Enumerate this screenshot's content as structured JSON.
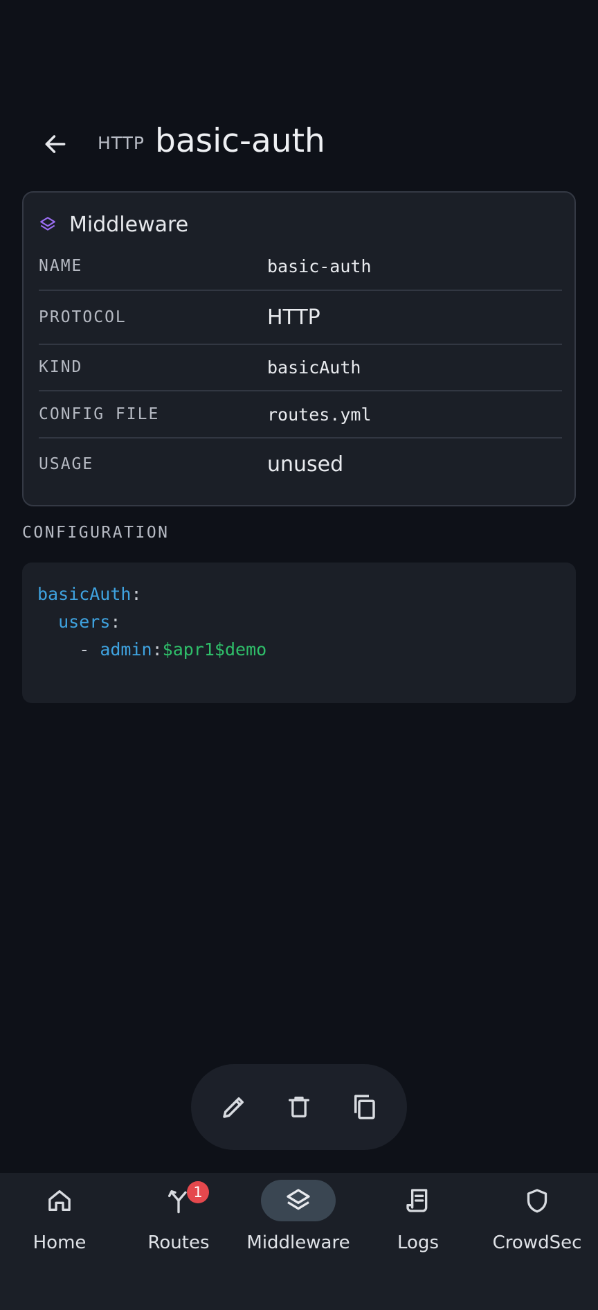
{
  "header": {
    "protocol": "HTTP",
    "title": "basic-auth"
  },
  "card": {
    "title": "Middleware",
    "rows": [
      {
        "key": "NAME",
        "value": "basic-auth"
      },
      {
        "key": "PROTOCOL",
        "value": "HTTP"
      },
      {
        "key": "KIND",
        "value": "basicAuth"
      },
      {
        "key": "CONFIG FILE",
        "value": "routes.yml"
      },
      {
        "key": "USAGE",
        "value": "unused"
      }
    ]
  },
  "configuration": {
    "label": "CONFIGURATION",
    "code": {
      "l1_key": "basicAuth",
      "l1_colon": ":",
      "l2_key": "users",
      "l2_colon": ":",
      "l3_dash": "- ",
      "l3_key": "admin",
      "l3_colon": ":",
      "l3_value": "$apr1$demo"
    }
  },
  "actions": [
    "edit-icon",
    "delete-icon",
    "copy-icon"
  ],
  "nav": {
    "items": [
      {
        "label": "Home",
        "icon": "home-icon"
      },
      {
        "label": "Routes",
        "icon": "routes-icon",
        "badge": "1"
      },
      {
        "label": "Middleware",
        "icon": "layers-icon",
        "active": true
      },
      {
        "label": "Logs",
        "icon": "logs-icon"
      },
      {
        "label": "CrowdSec",
        "icon": "shield-icon"
      }
    ]
  },
  "colors": {
    "background": "#0e1118",
    "surface": "#1b1f27",
    "accent": "#9b6ef3",
    "yaml_key": "#3fa3e0",
    "yaml_string": "#2fbf6a",
    "badge": "#e5484d"
  }
}
